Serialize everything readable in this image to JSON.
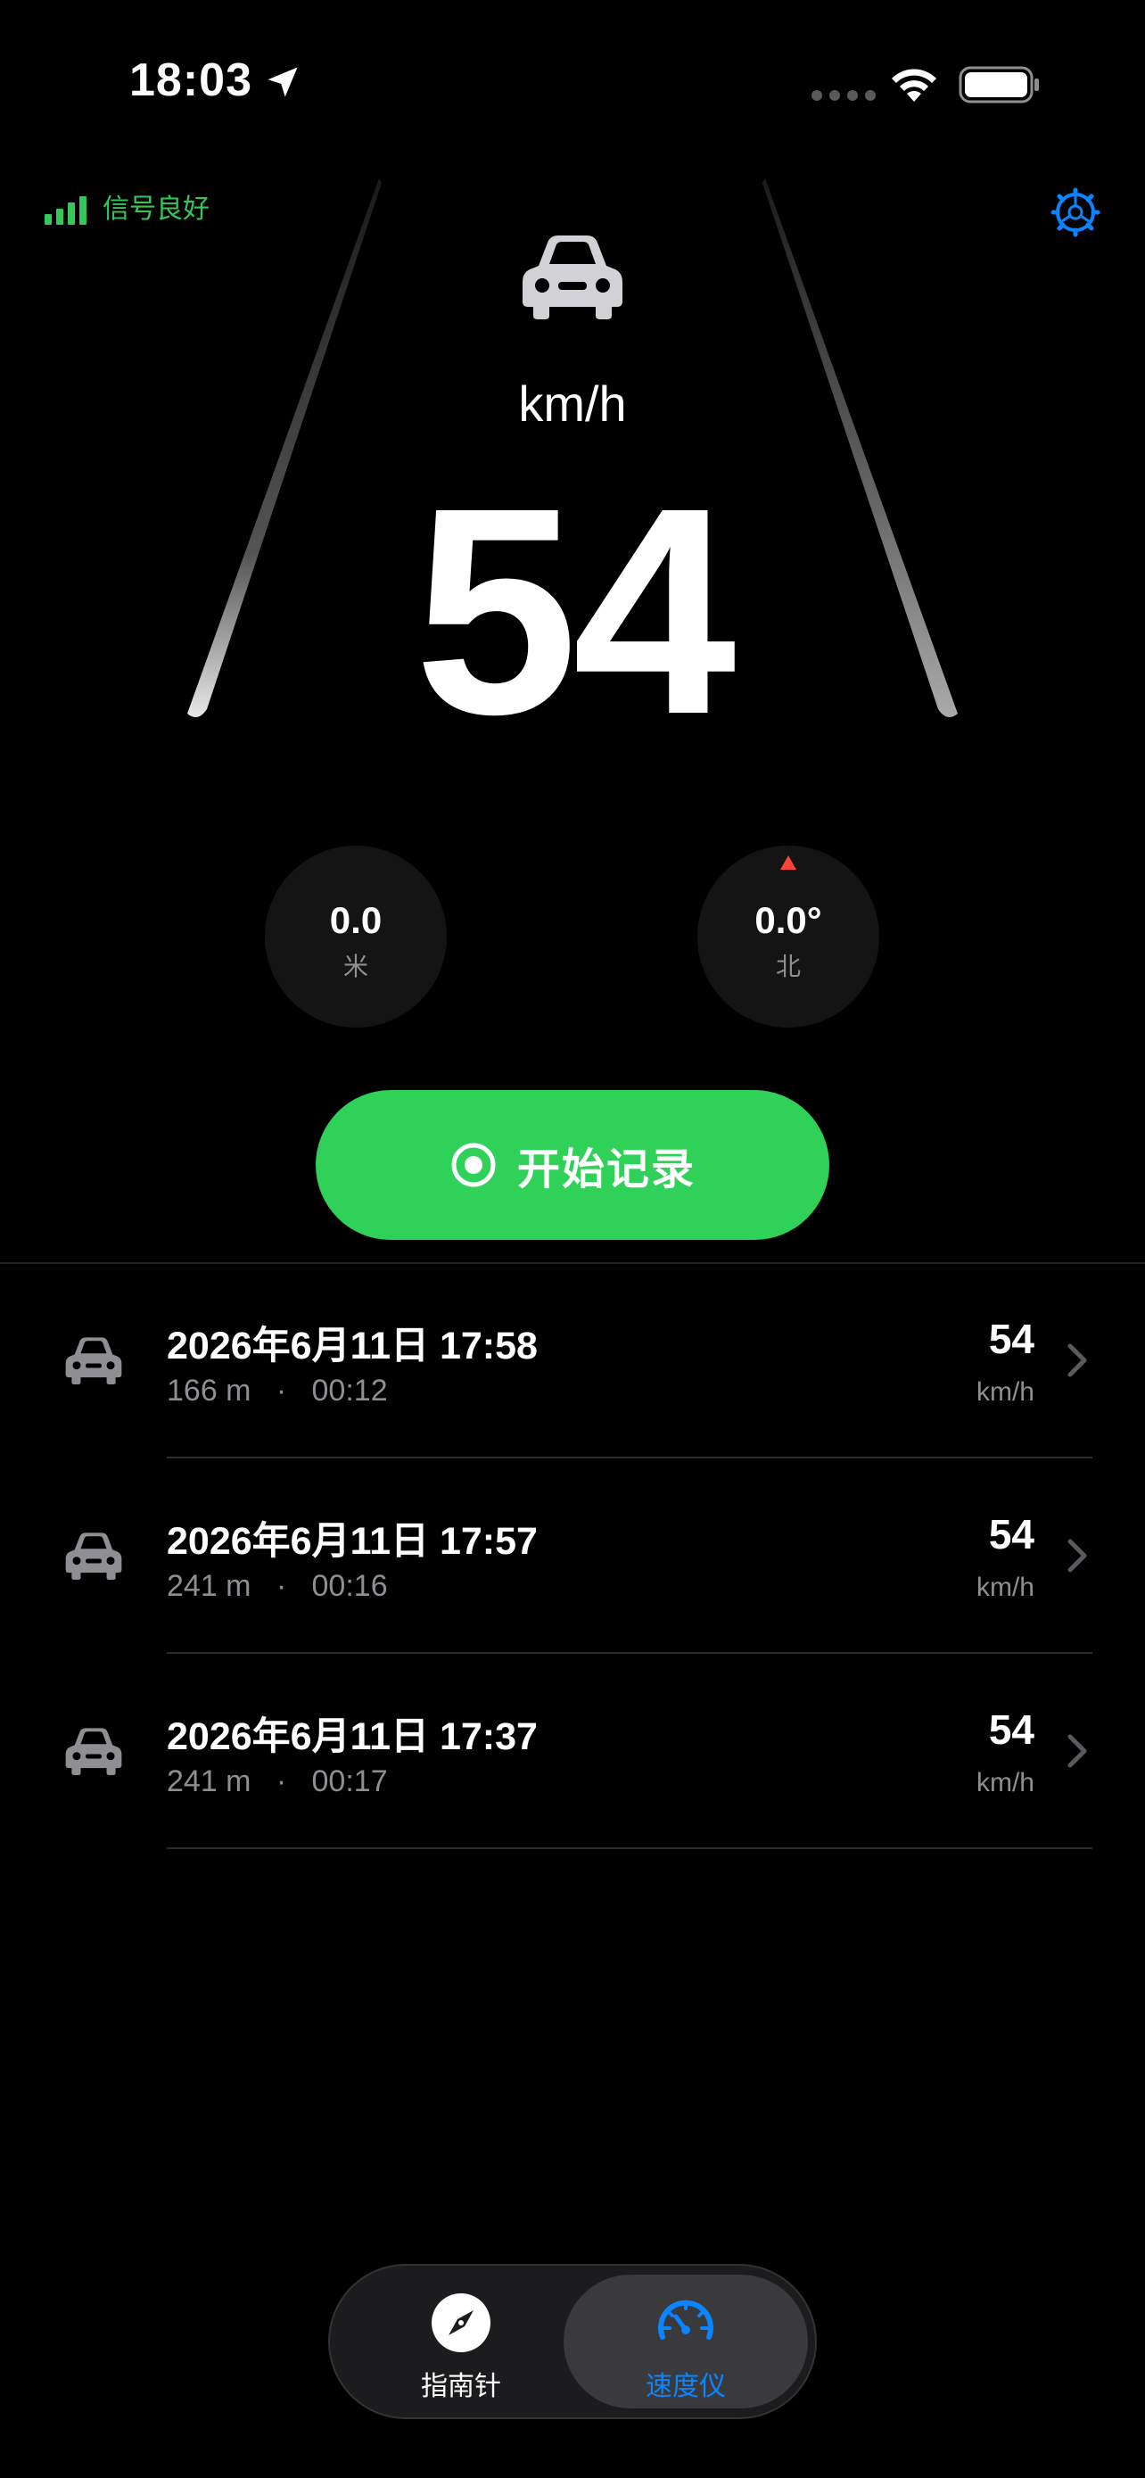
{
  "status_bar": {
    "time": "18:03",
    "icons": [
      "location-arrow-icon",
      "cellular-dots-icon",
      "wifi-icon",
      "battery-icon"
    ]
  },
  "header": {
    "signal_text": "信号良好",
    "signal_color": "#34c759",
    "settings_icon": "gear-icon",
    "accent_color": "#0a84ff"
  },
  "speedometer": {
    "vehicle_icon": "car-icon",
    "unit": "km/h",
    "speed": "54"
  },
  "gauges": {
    "distance": {
      "value": "0.0",
      "unit": "米"
    },
    "heading": {
      "value": "0.0°",
      "unit": "北",
      "marker_color": "#ff453a"
    }
  },
  "record_button": {
    "label": "开始记录",
    "icon": "record-circle-icon",
    "color": "#30d158"
  },
  "history": [
    {
      "title": "2026年6月11日 17:58",
      "distance": "166 m",
      "separator": "·",
      "duration": "00:12",
      "speed": "54",
      "unit": "km/h"
    },
    {
      "title": "2026年6月11日 17:57",
      "distance": "241 m",
      "separator": "·",
      "duration": "00:16",
      "speed": "54",
      "unit": "km/h"
    },
    {
      "title": "2026年6月11日 17:37",
      "distance": "241 m",
      "separator": "·",
      "duration": "00:17",
      "speed": "54",
      "unit": "km/h"
    }
  ],
  "tabbar": {
    "tabs": [
      {
        "label": "指南针",
        "icon": "compass-icon",
        "selected": false
      },
      {
        "label": "速度仪",
        "icon": "speedometer-icon",
        "selected": true
      }
    ]
  }
}
